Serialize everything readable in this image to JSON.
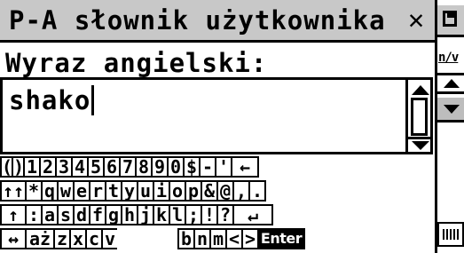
{
  "window": {
    "title": "P-A słownik użytkownika",
    "close_glyph": "✕"
  },
  "prompt_label": "Wyraz angielski:",
  "input": {
    "value": "shako"
  },
  "keyboard": {
    "rows": [
      [
        "(",
        ")",
        "1",
        "2",
        "3",
        "4",
        "5",
        "6",
        "7",
        "8",
        "9",
        "0",
        "$",
        "-",
        "'",
        "←"
      ],
      [
        "↑↑",
        "*",
        "q",
        "w",
        "e",
        "r",
        "t",
        "y",
        "u",
        "i",
        "o",
        "p",
        "&",
        "@",
        ",",
        "."
      ],
      [
        "↑",
        ":",
        "a",
        "s",
        "d",
        "f",
        "g",
        "h",
        "j",
        "k",
        "l",
        ";",
        "!",
        "?",
        "↵"
      ],
      [
        "↔",
        "aż",
        "z",
        "x",
        "c",
        "v",
        "",
        "b",
        "n",
        "m",
        "<",
        ">",
        "Enter"
      ]
    ]
  },
  "side": {
    "nv_label": "n/v"
  }
}
